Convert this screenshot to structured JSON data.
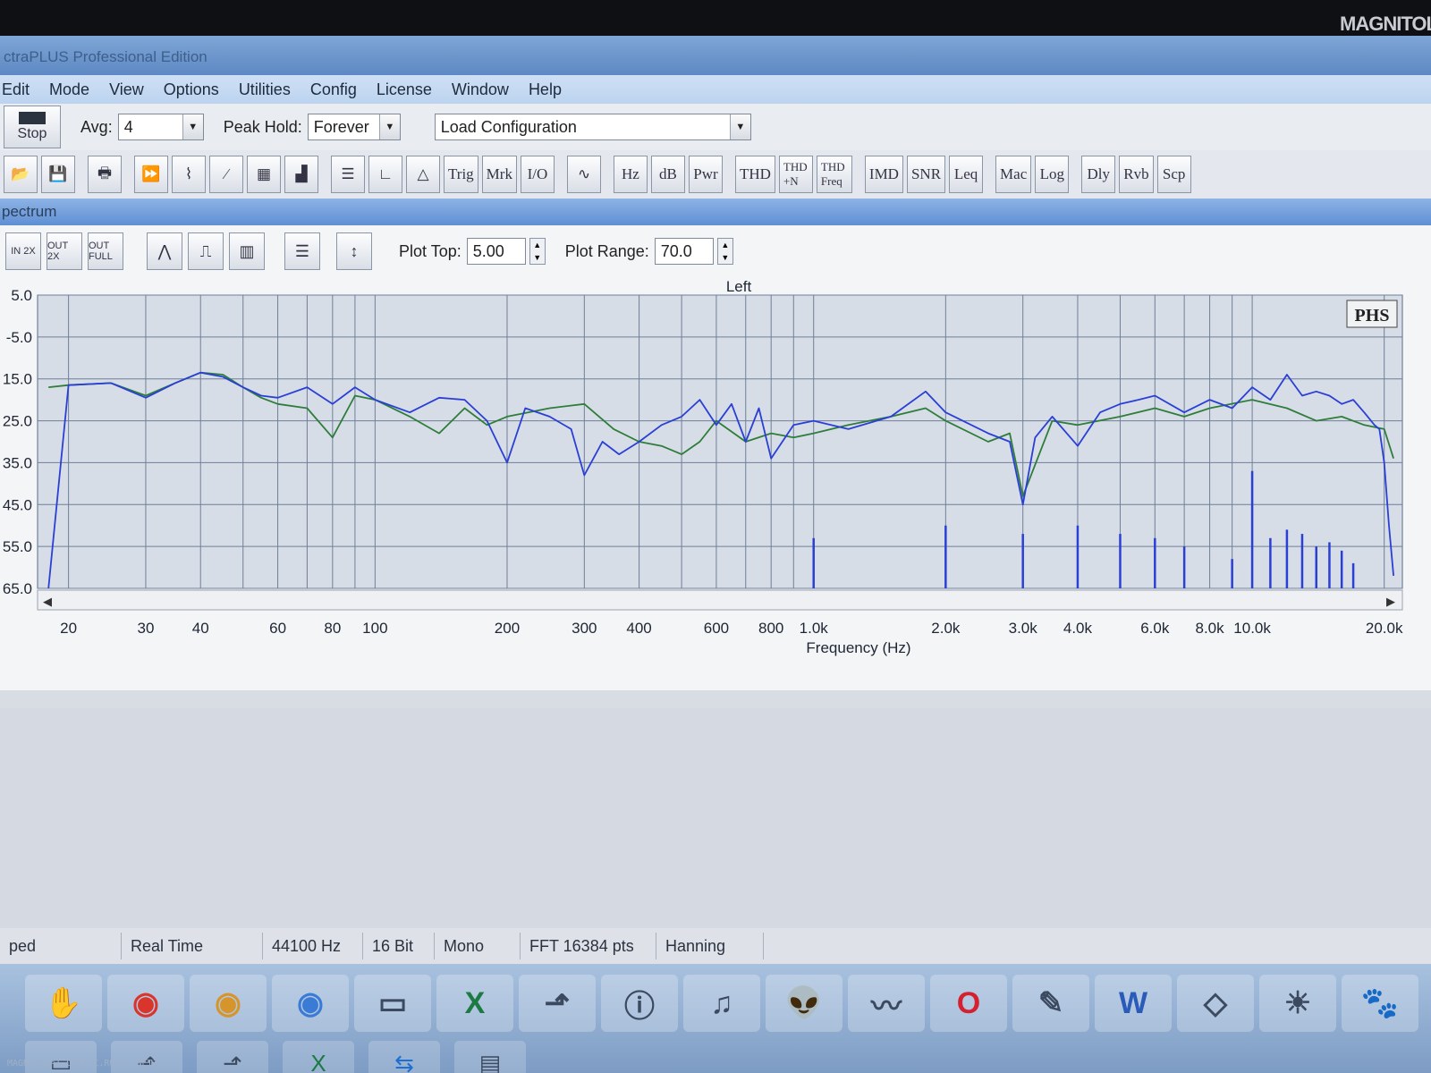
{
  "window": {
    "title": "ctraPLUS Professional Edition"
  },
  "menu": [
    "Edit",
    "Mode",
    "View",
    "Options",
    "Utilities",
    "Config",
    "License",
    "Window",
    "Help"
  ],
  "toolbar": {
    "stop_label": "Stop",
    "avg_label": "Avg:",
    "avg_value": "4",
    "peak_hold_label": "Peak Hold:",
    "peak_hold_value": "Forever",
    "load_config": "Load Configuration"
  },
  "tool_buttons": [
    "Trig",
    "Mrk",
    "I/O",
    "Hz",
    "dB",
    "Pwr",
    "THD",
    "THD +N",
    "THD Freq",
    "IMD",
    "SNR",
    "Leq",
    "Mac",
    "Log",
    "Dly",
    "Rvb",
    "Scp"
  ],
  "panel": {
    "title": "pectrum",
    "zoom_in_label": "IN 2X",
    "zoom_out_label": "OUT 2X",
    "zoom_full_label": "OUT FULL",
    "plot_top_label": "Plot Top:",
    "plot_top_value": "5.00",
    "plot_range_label": "Plot Range:",
    "plot_range_value": "70.0",
    "badge": "PHS"
  },
  "chart_data": {
    "type": "line",
    "title": "Left",
    "xlabel": "Frequency (Hz)",
    "xscale": "log",
    "xlim": [
      17,
      22000
    ],
    "ylim": [
      -65,
      5
    ],
    "yticks": [
      "5.0",
      "-5.0",
      "15.0",
      "25.0",
      "35.0",
      "45.0",
      "55.0",
      "65.0"
    ],
    "xticks": [
      {
        "v": 20,
        "label": "20"
      },
      {
        "v": 30,
        "label": "30"
      },
      {
        "v": 40,
        "label": "40"
      },
      {
        "v": 60,
        "label": "60"
      },
      {
        "v": 80,
        "label": "80"
      },
      {
        "v": 100,
        "label": "100"
      },
      {
        "v": 200,
        "label": "200"
      },
      {
        "v": 300,
        "label": "300"
      },
      {
        "v": 400,
        "label": "400"
      },
      {
        "v": 600,
        "label": "600"
      },
      {
        "v": 800,
        "label": "800"
      },
      {
        "v": 1000,
        "label": "1.0k"
      },
      {
        "v": 2000,
        "label": "2.0k"
      },
      {
        "v": 3000,
        "label": "3.0k"
      },
      {
        "v": 4000,
        "label": "4.0k"
      },
      {
        "v": 6000,
        "label": "6.0k"
      },
      {
        "v": 8000,
        "label": "8.0k"
      },
      {
        "v": 10000,
        "label": "10.0k"
      },
      {
        "v": 20000,
        "label": "20.0k"
      }
    ],
    "grid": true,
    "series": [
      {
        "color": "#2a3fd6",
        "x": [
          18,
          20,
          25,
          30,
          35,
          40,
          45,
          50,
          55,
          60,
          70,
          80,
          90,
          100,
          120,
          140,
          160,
          180,
          200,
          220,
          250,
          280,
          300,
          330,
          360,
          400,
          450,
          500,
          550,
          600,
          650,
          700,
          750,
          800,
          900,
          1000,
          1200,
          1500,
          1800,
          2000,
          2500,
          2800,
          3000,
          3200,
          3500,
          4000,
          4500,
          5000,
          5500,
          6000,
          7000,
          8000,
          9000,
          10000,
          11000,
          12000,
          13000,
          14000,
          15000,
          16000,
          17000,
          18000,
          19000,
          19500,
          20000,
          20500,
          21000
        ],
        "y": [
          -65,
          -16.5,
          -16,
          -19.5,
          -16,
          -13.5,
          -14.5,
          -17,
          -19,
          -19.5,
          -17,
          -21,
          -17,
          -20,
          -23,
          -19.5,
          -20,
          -25,
          -35,
          -22,
          -24,
          -27,
          -38,
          -30,
          -33,
          -30,
          -26,
          -24,
          -20,
          -26,
          -21,
          -30,
          -22,
          -34,
          -26,
          -25,
          -27,
          -24,
          -18,
          -23,
          -28,
          -30,
          -45,
          -29,
          -24,
          -31,
          -23,
          -21,
          -20,
          -19,
          -23,
          -20,
          -22,
          -17,
          -20,
          -14,
          -19,
          -18,
          -19,
          -21,
          -20,
          -23,
          -26,
          -27,
          -35,
          -50,
          -62
        ]
      },
      {
        "color": "#2e7d3a",
        "x": [
          18,
          20,
          25,
          30,
          35,
          40,
          45,
          50,
          55,
          60,
          70,
          80,
          90,
          100,
          120,
          140,
          160,
          180,
          200,
          250,
          300,
          350,
          400,
          450,
          500,
          550,
          600,
          700,
          800,
          900,
          1000,
          1200,
          1500,
          1800,
          2000,
          2500,
          2800,
          3000,
          3500,
          4000,
          5000,
          6000,
          7000,
          8000,
          10000,
          12000,
          14000,
          16000,
          18000,
          20000,
          21000
        ],
        "y": [
          -17,
          -16.5,
          -16,
          -19,
          -16,
          -13.5,
          -14,
          -17,
          -19.5,
          -21,
          -22,
          -29,
          -19,
          -20,
          -24,
          -28,
          -22,
          -26,
          -24,
          -22,
          -21,
          -27,
          -30,
          -31,
          -33,
          -30,
          -25,
          -30,
          -28,
          -29,
          -28,
          -26,
          -24,
          -22,
          -25,
          -30,
          -28,
          -43,
          -25,
          -26,
          -24,
          -22,
          -24,
          -22,
          -20,
          -22,
          -25,
          -24,
          -26,
          -27,
          -34
        ]
      }
    ],
    "spikes": [
      {
        "x": 1000,
        "top": -53
      },
      {
        "x": 2000,
        "top": -50
      },
      {
        "x": 3000,
        "top": -52
      },
      {
        "x": 4000,
        "top": -50
      },
      {
        "x": 5000,
        "top": -52
      },
      {
        "x": 6000,
        "top": -53
      },
      {
        "x": 7000,
        "top": -55
      },
      {
        "x": 9000,
        "top": -58
      },
      {
        "x": 10000,
        "top": -37
      },
      {
        "x": 11000,
        "top": -53
      },
      {
        "x": 12000,
        "top": -51
      },
      {
        "x": 13000,
        "top": -52
      },
      {
        "x": 14000,
        "top": -55
      },
      {
        "x": 15000,
        "top": -54
      },
      {
        "x": 16000,
        "top": -56
      },
      {
        "x": 17000,
        "top": -59
      }
    ],
    "spike_color": "#2a3fd6"
  },
  "status": {
    "state": "ped",
    "mode": "Real Time",
    "rate": "44100 Hz",
    "bits": "16 Bit",
    "channels": "Mono",
    "fft": "FFT 16384 pts",
    "window": "Hanning"
  },
  "taskbar_icons": [
    "hand-icon",
    "chrome-icon",
    "chrome-canary-icon",
    "chrome-beta-icon",
    "folder-icon",
    "excel-icon",
    "chart-app-icon",
    "info-tool-icon",
    "audio-app-icon",
    "alien-icon",
    "spectrum-app-icon",
    "opera-icon",
    "paint-icon",
    "word-icon",
    "explorer-icon",
    "sun-app-icon",
    "gimp-icon"
  ],
  "brand": {
    "logo": "MAGNITOLA",
    "watermark": "MAGNITOLAT.ORG1 C.RU1 I.NET1"
  }
}
